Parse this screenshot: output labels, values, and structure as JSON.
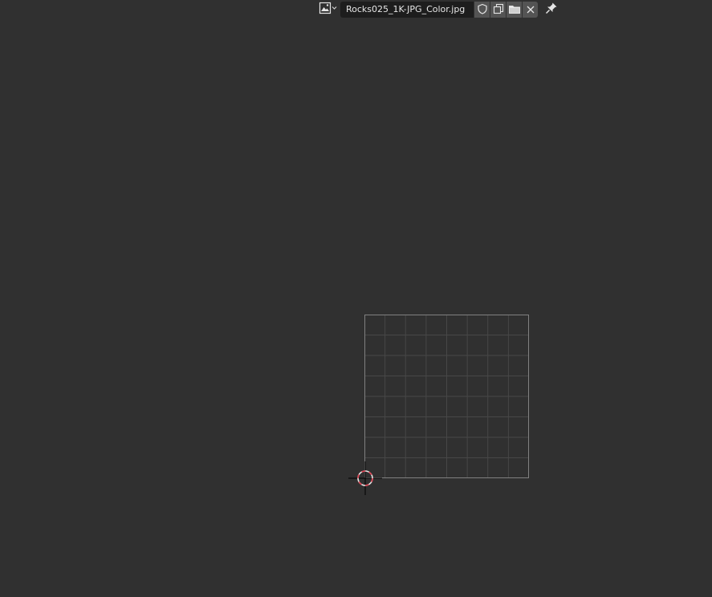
{
  "header": {
    "image_name": "Rocks025_1K-JPG_Color.jpg",
    "browse_icon": "image-icon",
    "buttons": [
      "fake-user-shield-icon",
      "duplicate-image-icon",
      "open-folder-icon",
      "close-x-icon"
    ],
    "pin_icon": "pin-icon"
  },
  "viewport": {
    "grid_divisions": 8,
    "cursor": "2d-cursor-icon"
  },
  "colors": {
    "background": "#303030",
    "field": "#1d1d1d",
    "button": "#545454",
    "grid_line": "#4a4a4a",
    "grid_border": "#8a8a8a",
    "cursor_red": "#e04050"
  }
}
